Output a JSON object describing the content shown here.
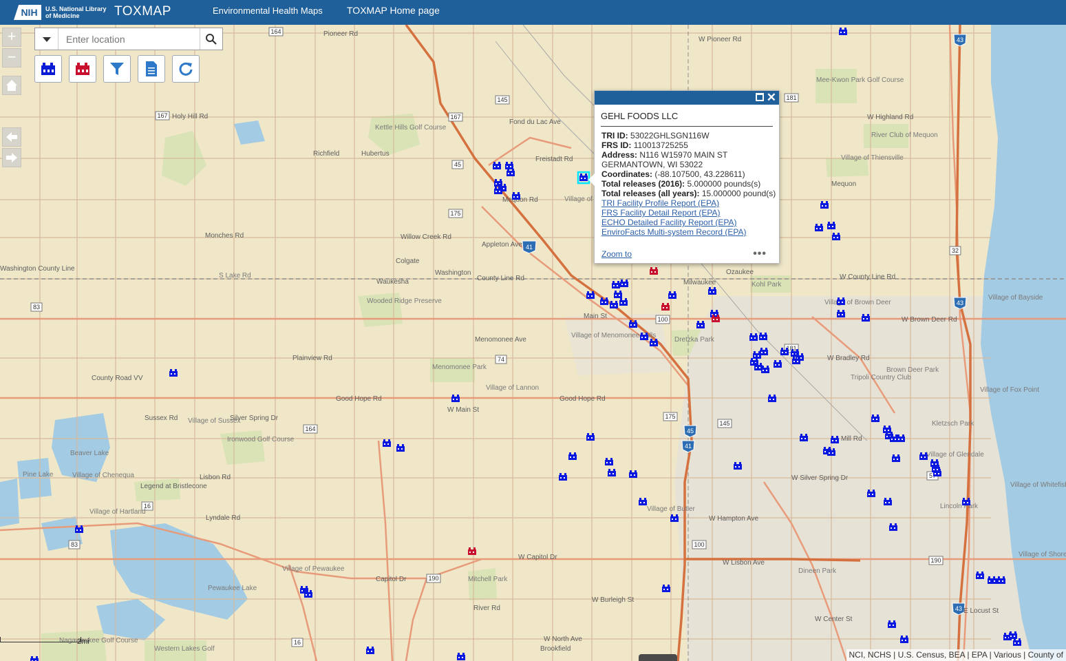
{
  "header": {
    "nih_badge": "NIH",
    "nih_text": "U.S. National Library of Medicine",
    "app_title": "TOXMAP",
    "nav": [
      "Environmental Health Maps",
      "TOXMAP Home page"
    ]
  },
  "search": {
    "placeholder": "Enter location"
  },
  "controls": {
    "zoom_in": "+",
    "zoom_out": "−"
  },
  "toolbar": [
    {
      "name": "tri-facilities-layer",
      "icon": "factory-blue-icon"
    },
    {
      "name": "superfund-layer",
      "icon": "factory-red-icon"
    },
    {
      "name": "filter",
      "icon": "filter-icon"
    },
    {
      "name": "report",
      "icon": "document-icon"
    },
    {
      "name": "refresh",
      "icon": "refresh-icon"
    }
  ],
  "popup": {
    "title": "GEHL FOODS LLC",
    "tri_id_label": "TRI ID:",
    "tri_id": "53022GHLSGN116W",
    "frs_id_label": "FRS ID:",
    "frs_id": "110013725255",
    "address_label": "Address:",
    "address_line1": "N116 W15970 MAIN ST",
    "address_line2": "GERMANTOWN, WI 53022",
    "coords_label": "Coordinates:",
    "coords": "(-88.107500, 43.228611)",
    "releases_2016_label": "Total releases (2016):",
    "releases_2016": "5.000000 pounds(s)",
    "releases_all_label": "Total releases (all years):",
    "releases_all": "15.000000 pound(s)",
    "links": [
      "TRI Facility Profile Report (EPA)",
      "FRS Facility Detail Report (EPA)",
      "ECHO Detailed Facility Report (EPA)",
      "EnviroFacts Multi-system Record (EPA)"
    ],
    "zoom_to": "Zoom to",
    "more": "•••"
  },
  "attribution": "NCI, NCHS | U.S. Census, BEA | EPA | Various | County of",
  "scale_label": "2mi",
  "map_labels": [
    "Pioneer Rd",
    "W Pioneer Rd",
    "Holy Hill Rd",
    "Kettle Hills Golf Course",
    "Hubertus",
    "Richfield",
    "Freistadt Rd",
    "Mequon Rd",
    "Monches Rd",
    "Willow Creek Rd",
    "Colgate",
    "Washington",
    "County Line Rd",
    "W County Line Rd",
    "S Lake Rd",
    "Waukesha",
    "Wooded Ridge Preserve",
    "Menomonee Ave",
    "Village of Menomonee Falls",
    "Main St",
    "Plainview Rd",
    "County Road VV",
    "Menomonee Park",
    "Village of Lannon",
    "Good Hope Rd",
    "W Main St",
    "Sussex Rd",
    "Village of Sussex",
    "Silver Spring Dr",
    "W Silver Spring Dr",
    "Ironwood Golf Course",
    "Beaver Lake",
    "Pine Lake",
    "Village of Chenequa",
    "Lisbon Rd",
    "Legend at Bristlecone",
    "Village of Hartland",
    "Lyndale Rd",
    "Village of Pewaukee",
    "Capitol Dr",
    "W Capitol Dr",
    "Pewaukee Lake",
    "Mitchell Park",
    "River Rd",
    "W Burleigh St",
    "W North Ave",
    "Brookfield",
    "Village of Butler",
    "W Hampton Ave",
    "Dineen Park",
    "W Lisbon Ave",
    "W Bradley Rd",
    "Dretzka Park",
    "Village of Brown Deer",
    "W Brown Deer Rd",
    "Village of Thiensville",
    "Mequon",
    "Village of Bayside",
    "Village of Fox Point",
    "Kletzsch Park",
    "Village of Glendale",
    "Lincoln Park",
    "Village of Whitefish Bay",
    "Village of Shorewood",
    "Milwaukee",
    "Ozaukee",
    "Mee-Kwon Park Golf Course",
    "River Club of Mequon",
    "W Highland Rd",
    "Mill Rd",
    "Tripoli Country Club",
    "Brown Deer Park",
    "Kohl Park",
    "Good Hope Rd",
    "W Center St",
    "E Locust St",
    "Appleton Ave",
    "Fond du Lac Ave",
    "Village of Germantown",
    "Nagawaukee Golf Course",
    "Western Lakes Golf",
    "Washington County Line"
  ]
}
